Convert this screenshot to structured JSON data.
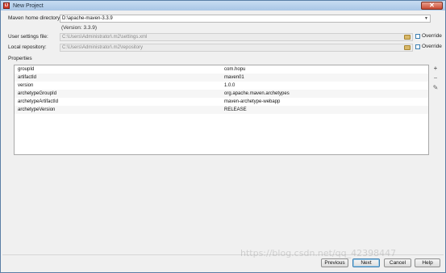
{
  "window": {
    "title": "New Project",
    "close_glyph": "✕"
  },
  "form": {
    "maven_home_label": "Maven home directory:",
    "maven_home_value": "D:\\apache-maven-3.3.9",
    "version_hint": "(Version: 3.3.9)",
    "user_settings_label": "User settings file:",
    "user_settings_value": "C:\\Users\\Administrator\\.m2\\settings.xml",
    "local_repo_label": "Local repository:",
    "local_repo_value": "C:\\Users\\Administrator\\.m2\\repository",
    "override_label": "Override"
  },
  "properties": {
    "label": "Properties",
    "rows": [
      {
        "key": "groupId",
        "value": "com.hopu"
      },
      {
        "key": "artifactId",
        "value": "maven01"
      },
      {
        "key": "version",
        "value": "1.0.0"
      },
      {
        "key": "archetypeGroupId",
        "value": "org.apache.maven.archetypes"
      },
      {
        "key": "archetypeArtifactId",
        "value": "maven-archetype-webapp"
      },
      {
        "key": "archetypeVersion",
        "value": "RELEASE"
      }
    ],
    "tools": [
      "+",
      "−",
      "✎"
    ]
  },
  "buttons": {
    "previous": "Previous",
    "next": "Next",
    "cancel": "Cancel",
    "help": "Help"
  },
  "watermark": "https://blog.csdn.net/qq_42398447"
}
